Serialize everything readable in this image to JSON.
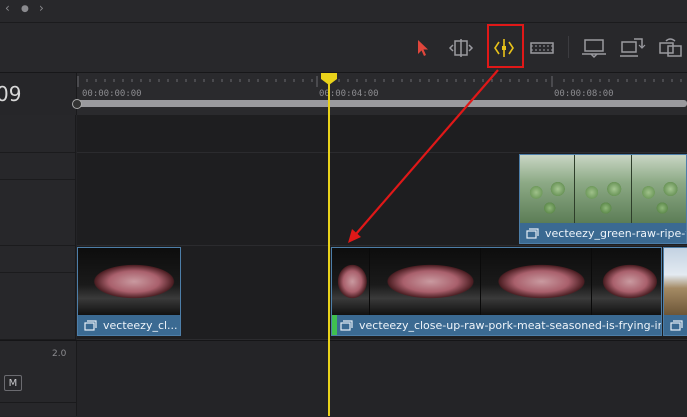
{
  "top_nav": {
    "prev_glyph": "‹",
    "dot_glyph": "●",
    "next_glyph": "›"
  },
  "toolbar": {
    "tools": [
      {
        "name": "selection-mode",
        "icon": "arrow-pointer-icon",
        "active": false
      },
      {
        "name": "trim-edit-mode",
        "icon": "trim-icon",
        "active": false
      },
      {
        "name": "dynamic-trim-mode",
        "icon": "dynamic-trim-icon",
        "active": true
      },
      {
        "name": "blade-edit-mode",
        "icon": "blade-icon",
        "active": false
      },
      {
        "name": "insert-clip",
        "icon": "insert-clip-icon",
        "active": false
      },
      {
        "name": "overwrite-clip",
        "icon": "overwrite-clip-icon",
        "active": false
      },
      {
        "name": "replace-clip",
        "icon": "replace-clip-icon",
        "active": false
      }
    ],
    "highlight_color": "#e01818",
    "active_color": "#e8c21a"
  },
  "timeline": {
    "timecode_partial": "09",
    "ruler_labels": [
      "00:00:00:00",
      "00:00:04:00",
      "00:00:08:00"
    ],
    "playhead_color": "#e9d21a"
  },
  "clips": [
    {
      "name": "vecteezy_cl...",
      "type": "video",
      "thumb": "meat"
    },
    {
      "name": "vecteezy_close-up-raw-pork-meat-seasoned-is-frying-in-...",
      "type": "video",
      "thumb": "meat"
    },
    {
      "name": "vecteezy_green-raw-ripe-wa",
      "type": "video",
      "thumb": "green"
    }
  ],
  "audio": {
    "gain_label": "2.0",
    "mute_label": "M"
  },
  "annotation": {
    "arrow_color": "#e01818"
  }
}
